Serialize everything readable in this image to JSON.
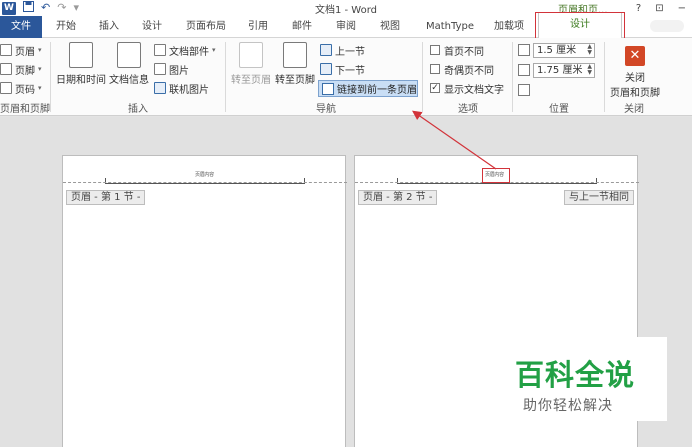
{
  "titlebar": {
    "app_letter": "W",
    "undo_glyph": "↶",
    "redo_glyph": "↷",
    "qat_caret": "▾",
    "document_title": "文档1 - Word",
    "context_group_label": "页眉和页...",
    "help_glyph": "?",
    "restore_glyph": "⊡",
    "minimize_glyph": "−"
  },
  "tabs": {
    "file": "文件",
    "items": [
      "开始",
      "插入",
      "设计",
      "页面布局",
      "引用",
      "邮件",
      "审阅",
      "视图",
      "MathType",
      "加载项"
    ],
    "design": "设计"
  },
  "ribbon": {
    "hf_group": {
      "header": "页眉",
      "footer": "页脚",
      "page_number": "页码",
      "label": "页眉和页脚"
    },
    "insert_group": {
      "datetime": "日期和时间",
      "docinfo": "文档信息",
      "docparts": "文档部件",
      "picture": "图片",
      "online_picture": "联机图片",
      "label": "插入"
    },
    "nav_group": {
      "goto_header": "转至页眉",
      "goto_footer": "转至页脚",
      "previous": "上一节",
      "next": "下一节",
      "link_previous": "链接到前一条页眉",
      "label": "导航"
    },
    "options_group": {
      "diff_first": "首页不同",
      "diff_odd_even": "奇偶页不同",
      "show_doc_text": "显示文档文字",
      "show_doc_text_checked": true,
      "label": "选项"
    },
    "position_group": {
      "header_from_top": "1.5 厘米",
      "footer_from_bottom": "1.75 厘米",
      "label": "位置"
    },
    "close_group": {
      "close_line1": "关闭",
      "close_line2": "页眉和页脚",
      "label": "关闭"
    }
  },
  "pages": [
    {
      "tag": "页眉 - 第 1 节 -",
      "header_text": "页眉内容"
    },
    {
      "tag": "页眉 - 第 2 节 -",
      "header_text": "页眉内容",
      "link_tag": "与上一节相同"
    }
  ],
  "watermark": {
    "title": "百科全说",
    "subtitle": "助你轻松解决"
  },
  "colors": {
    "word_blue": "#2b579a",
    "context_green": "#3a7a1c",
    "annotation_red": "#d2333a",
    "watermark_green": "#22a045"
  }
}
